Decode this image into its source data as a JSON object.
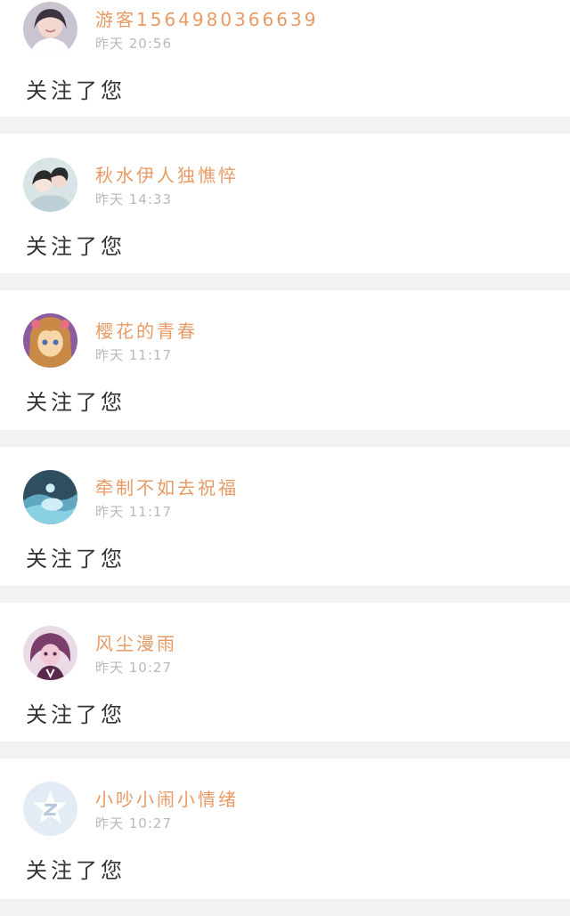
{
  "notifications": [
    {
      "username": "游客1564980366639",
      "timestamp": "昨天 20:56",
      "message": "关注了您",
      "avatar": {
        "name": "avatar-girl-photo",
        "colors": [
          "#c9c4cf",
          "#f3d8cf",
          "#3b3340",
          "#ffffff"
        ]
      }
    },
    {
      "username": "秋水伊人独憔悴",
      "timestamp": "昨天 14:33",
      "message": "关注了您",
      "avatar": {
        "name": "avatar-couple-photo",
        "colors": [
          "#d9e4e6",
          "#f6e4dc",
          "#2b2b2b",
          "#bcd0d6"
        ]
      }
    },
    {
      "username": "樱花的青春",
      "timestamp": "昨天 11:17",
      "message": "关注了您",
      "avatar": {
        "name": "avatar-anime-girl",
        "colors": [
          "#8c5a9e",
          "#f7d6a8",
          "#c98a48",
          "#e76f84"
        ]
      }
    },
    {
      "username": "牵制不如去祝福",
      "timestamp": "昨天 11:17",
      "message": "关注了您",
      "avatar": {
        "name": "avatar-blue-scene",
        "colors": [
          "#2f4f60",
          "#88d0e2",
          "#cfeef6",
          "#5fa8c0"
        ]
      }
    },
    {
      "username": "风尘漫雨",
      "timestamp": "昨天 10:27",
      "message": "关注了您",
      "avatar": {
        "name": "avatar-pink-doll",
        "colors": [
          "#eadbe6",
          "#7b3e6a",
          "#f2c7d8",
          "#5a2a4e"
        ]
      }
    },
    {
      "username": "小吵小闹小情绪",
      "timestamp": "昨天 10:27",
      "message": "关注了您",
      "avatar": {
        "name": "avatar-default-qq",
        "colors": [
          "#e3ebf4",
          "#ffffff",
          "#b6c9dd"
        ]
      }
    }
  ],
  "colors": {
    "username": "#e89a64",
    "timestamp": "#b9b9b9",
    "message": "#333333",
    "background": "#f2f2f2",
    "card": "#ffffff"
  }
}
